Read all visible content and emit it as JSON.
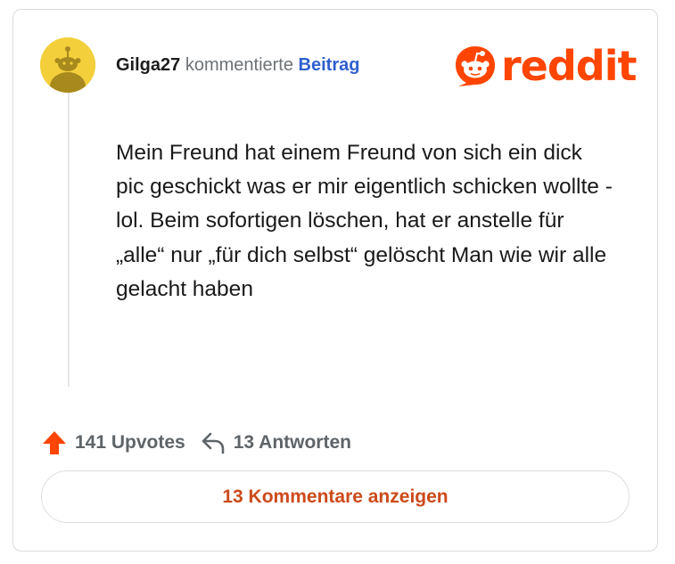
{
  "comment": {
    "username": "Gilga27",
    "action_text": "kommentierte",
    "post_link": "Beitrag",
    "body": "Mein Freund hat einem Freund von sich ein dick pic geschickt was er mir eigentlich schicken wollte - lol. Beim sofortigen löschen, hat er anstelle für „alle“ nur „für dich selbst“ gelöscht Man wie wir alle gelacht haben"
  },
  "brand": {
    "wordmark": "reddit",
    "color": "#ff4500"
  },
  "avatar": {
    "background": "#f3cf3b",
    "icon": "snoo-avatar-icon"
  },
  "stats": {
    "upvotes": "141 Upvotes",
    "replies": "13 Antworten",
    "upvote_icon": "upvote-arrow-icon",
    "reply_icon": "reply-arrow-icon",
    "upvote_color": "#ff4500"
  },
  "actions": {
    "view_comments": "13 Kommentare anzeigen"
  }
}
